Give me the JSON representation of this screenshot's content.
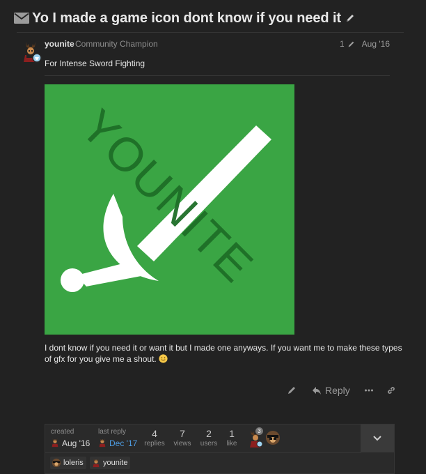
{
  "topic": {
    "title": "Yo I made a game icon dont know if you need it"
  },
  "post": {
    "username": "younite",
    "user_title": "Community Champion",
    "edit_count": "1",
    "date": "Aug '16",
    "subtitle": "For Intense Sword Fighting",
    "image_watermark": "YOUNITE",
    "body": "I dont know if you need it or want it but I made one anyways. If you want me to make these types of gfx for you give me a shout.",
    "image_colors": {
      "background": "#3aa544",
      "sword": "#ffffff",
      "watermark": "#1d6e27"
    }
  },
  "actions": {
    "reply_label": "Reply"
  },
  "topic_map": {
    "created_label": "created",
    "created_date": "Aug '16",
    "last_reply_label": "last reply",
    "last_reply_date": "Dec '17",
    "replies_count": "4",
    "replies_label": "replies",
    "views_count": "7",
    "views_label": "views",
    "users_count": "2",
    "users_label": "users",
    "likes_count": "1",
    "likes_label": "like",
    "avatar_badge_count": "3",
    "participants": [
      "loleris",
      "younite"
    ]
  },
  "colors": {
    "background": "#222222",
    "link_blue": "#4d9be0",
    "muted": "#8f8f8f"
  }
}
